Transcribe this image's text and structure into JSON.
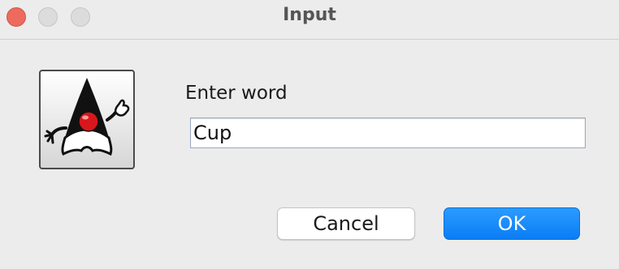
{
  "window": {
    "title": "Input"
  },
  "dialog": {
    "prompt": "Enter word",
    "input_value": "Cup",
    "cancel_label": "Cancel",
    "ok_label": "OK",
    "icon": "duke-java-mascot-icon"
  },
  "colors": {
    "close_button": "#ed6a5e",
    "ok_button": "#0a7df5",
    "window_background": "#ececec"
  }
}
